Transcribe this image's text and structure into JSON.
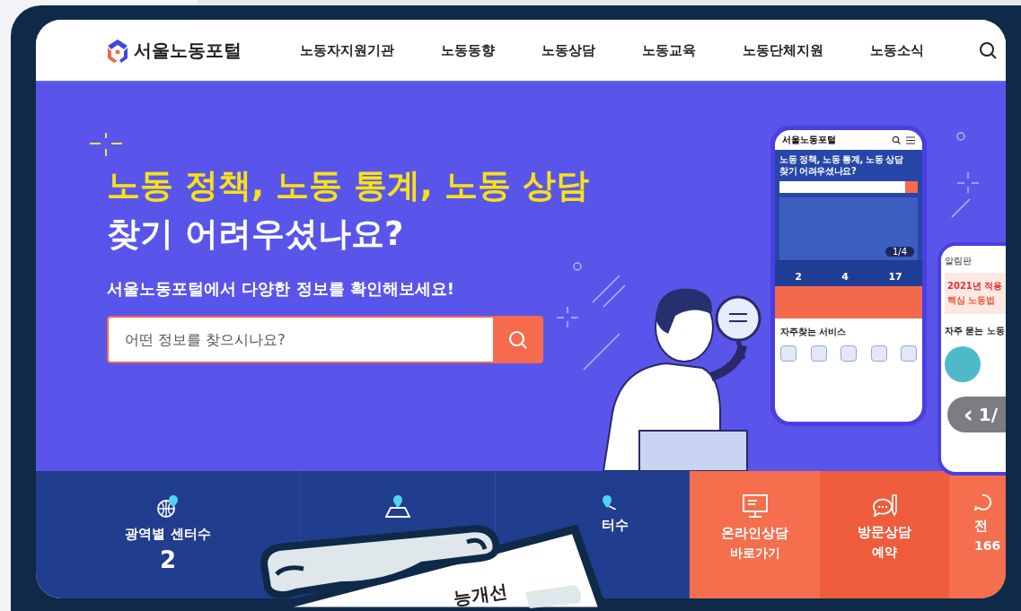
{
  "header": {
    "logo": "서울노동포털",
    "nav": [
      {
        "label": "노동자지원기관"
      },
      {
        "label": "노동동향"
      },
      {
        "label": "노동상담"
      },
      {
        "label": "노동교육"
      },
      {
        "label": "노동단체지원"
      },
      {
        "label": "노동소식"
      }
    ]
  },
  "hero": {
    "headline_highlight": "노동 정책, 노동 통계, 노동 상담",
    "headline": "찾기 어려우셨나요?",
    "subtitle": "서울노동포털에서 다양한 정보를 확인해보세요!",
    "search": {
      "placeholder": "어떤 정보를 찾으시나요?"
    }
  },
  "phone_preview": {
    "logo": "서울노동포털",
    "headline_highlight": "노동 정책, 노동 통계, 노동 상담",
    "headline": "찾기 어려우셨나요?",
    "stats": [
      "2",
      "4",
      "17"
    ],
    "section_title": "자주찾는 서비스",
    "pager": "1/4"
  },
  "notice_preview": {
    "title": "알림판",
    "banner_1": "2021년 적용",
    "banner_2": "핵심 노동법",
    "section_title": "자주 묻는 노동",
    "pager_prev": "‹",
    "pager": "1/"
  },
  "stats": [
    {
      "kind": "count",
      "label": "광역별 센터수",
      "value": "2"
    },
    {
      "kind": "count"
    },
    {
      "kind": "count",
      "label": "터수"
    },
    {
      "kind": "link",
      "label": "온라인상담",
      "sub": "바로가기"
    },
    {
      "kind": "link",
      "label": "방문상담",
      "sub": "예약"
    },
    {
      "kind": "link",
      "label": "전",
      "sub": "166"
    }
  ],
  "clipboard": {
    "text": "능개선"
  }
}
